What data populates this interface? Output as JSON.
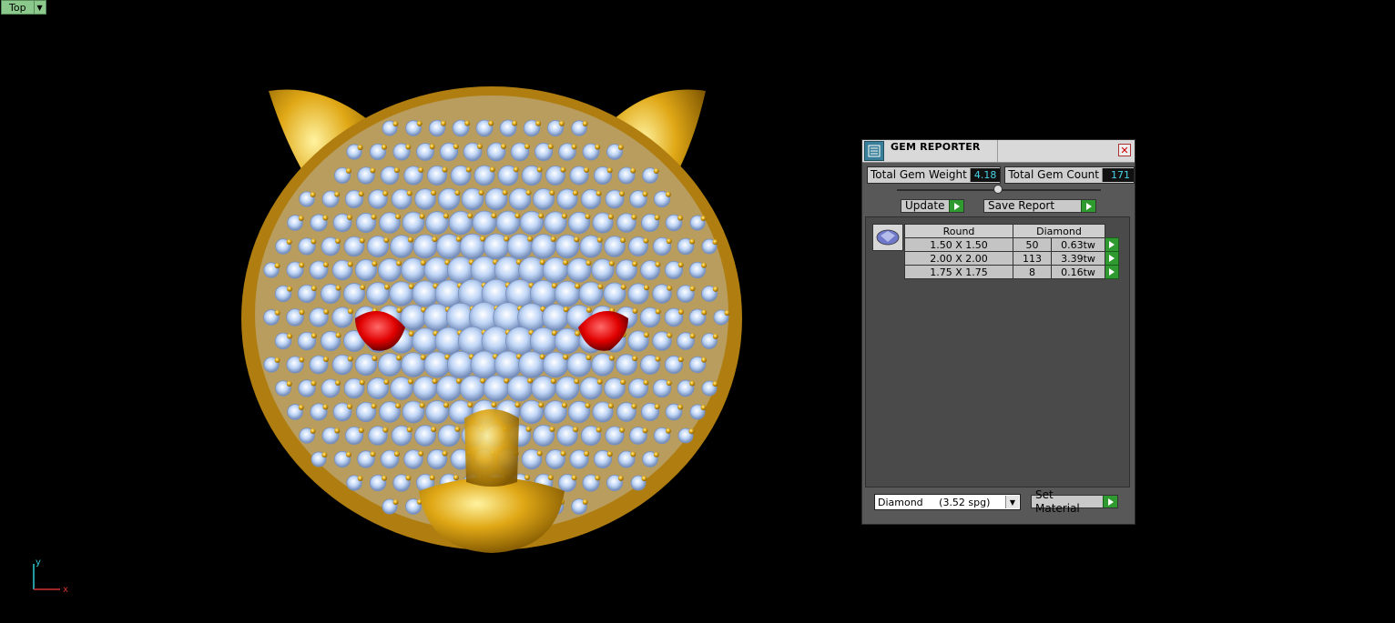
{
  "viewport": {
    "name": "Top",
    "axis_x": "x",
    "axis_y": "y"
  },
  "panel": {
    "title": "GEM REPORTER",
    "close_glyph": "✕",
    "total_weight_label": "Total Gem Weight",
    "total_weight_value": "4.18",
    "total_count_label": "Total Gem Count",
    "total_count_value": "171",
    "update_label": "Update",
    "save_report_label": "Save Report",
    "table": {
      "headers": [
        "Round",
        "Diamond"
      ],
      "rows": [
        {
          "size": "1.50 X 1.50",
          "count": "50",
          "weight": "0.63tw"
        },
        {
          "size": "2.00 X 2.00",
          "count": "113",
          "weight": "3.39tw"
        },
        {
          "size": "1.75 X 1.75",
          "count": "8",
          "weight": "0.16tw"
        }
      ]
    },
    "material_select": "Diamond     (3.52 spg)",
    "set_material_label": "Set Material"
  },
  "colors": {
    "gold": "#d4a017",
    "diamond": "#aac8f0",
    "ruby": "#e00000",
    "accent_green": "#2f9a2f",
    "readout_cyan": "#49d3e8"
  }
}
